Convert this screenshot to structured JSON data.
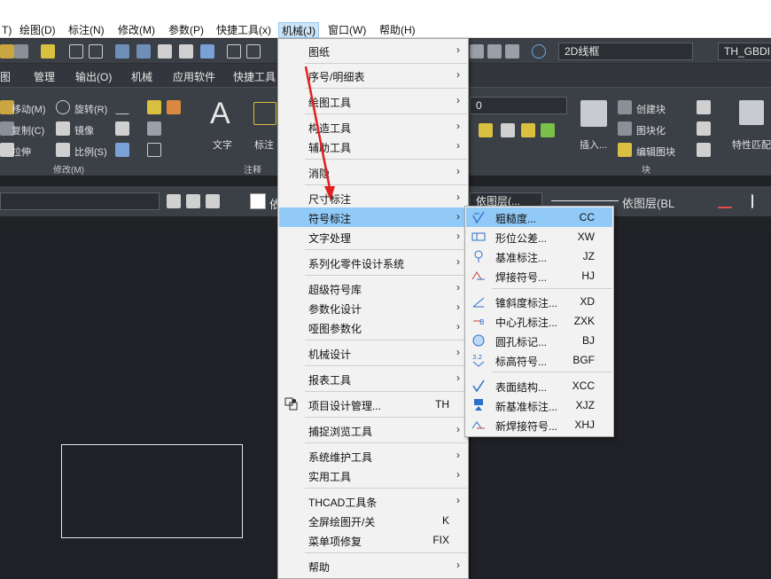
{
  "menubar": {
    "items": [
      "T)",
      "绘图(D)",
      "标注(N)",
      "修改(M)",
      "参数(P)",
      "快捷工具(x)",
      "机械(J)",
      "窗口(W)",
      "帮助(H)"
    ],
    "active_index": 6
  },
  "toolbar": {
    "view_style": "2D线框",
    "text_style": "TH_GBDIM"
  },
  "tabs": [
    "图",
    "管理",
    "输出(O)",
    "机械",
    "应用软件",
    "快捷工具"
  ],
  "ribbon": {
    "modify": {
      "move": "移动(M)",
      "rotate": "旋转(R)",
      "copy": "复制(C)",
      "mirror": "镜像",
      "stretch": "拉伸",
      "scale": "比例(S)",
      "group": "修改(M)"
    },
    "text": "文字",
    "dim": "标注",
    "annotate_group": "注释",
    "layer_value": "0",
    "insert": "插入...",
    "block": {
      "create": "创建块",
      "blockify": "图块化",
      "edit": "编辑图块",
      "group": "块"
    },
    "match_props": "特性匹配"
  },
  "props": {
    "left_label": "依",
    "layer": "依图层(...",
    "linetype": "依图层(BL"
  },
  "main_menu": [
    {
      "label": "图纸",
      "submenu": true
    },
    {
      "sep": true
    },
    {
      "label": "序号/明细表",
      "submenu": true
    },
    {
      "sep": true
    },
    {
      "label": "绘图工具",
      "submenu": true
    },
    {
      "sep": true
    },
    {
      "label": "构造工具",
      "submenu": true
    },
    {
      "label": "辅助工具",
      "submenu": true
    },
    {
      "sep": true
    },
    {
      "label": "消隐",
      "submenu": true
    },
    {
      "sep": true
    },
    {
      "label": "尺寸标注",
      "submenu": true
    },
    {
      "label": "符号标注",
      "submenu": true,
      "highlight": true
    },
    {
      "label": "文字处理",
      "submenu": true
    },
    {
      "sep": true
    },
    {
      "label": "系列化零件设计系统",
      "submenu": true
    },
    {
      "sep": true
    },
    {
      "label": "超级符号库",
      "submenu": true
    },
    {
      "label": "参数化设计",
      "submenu": true
    },
    {
      "label": "哑图参数化",
      "submenu": true
    },
    {
      "sep": true
    },
    {
      "label": "机械设计",
      "submenu": true
    },
    {
      "sep": true
    },
    {
      "label": "报表工具",
      "submenu": true
    },
    {
      "sep": true
    },
    {
      "label": "项目设计管理...",
      "shortcut": "TH",
      "icon": "project-icon"
    },
    {
      "sep": true
    },
    {
      "label": "捕捉浏览工具",
      "submenu": true
    },
    {
      "sep": true
    },
    {
      "label": "系统维护工具",
      "submenu": true
    },
    {
      "label": "实用工具",
      "submenu": true
    },
    {
      "sep": true
    },
    {
      "label": "THCAD工具条",
      "submenu": true
    },
    {
      "label": "全屏绘图开/关",
      "shortcut": "K"
    },
    {
      "label": "菜单项修复",
      "shortcut": "FIX"
    },
    {
      "sep": true
    },
    {
      "label": "帮助",
      "submenu": true
    }
  ],
  "sub_menu": [
    {
      "label": "粗糙度...",
      "shortcut": "CC",
      "icon": "roughness-icon",
      "highlight": true
    },
    {
      "label": "形位公差...",
      "shortcut": "XW",
      "icon": "tolerance-icon"
    },
    {
      "label": "基准标注...",
      "shortcut": "JZ",
      "icon": "datum-icon"
    },
    {
      "label": "焊接符号...",
      "shortcut": "HJ",
      "icon": "weld-icon"
    },
    {
      "sep": true
    },
    {
      "label": "锥斜度标注...",
      "shortcut": "XD",
      "icon": "taper-icon"
    },
    {
      "label": "中心孔标注...",
      "shortcut": "ZXK",
      "icon": "center-hole-icon"
    },
    {
      "label": "圆孔标记...",
      "shortcut": "BJ",
      "icon": "hole-mark-icon"
    },
    {
      "label": "标高符号...",
      "shortcut": "BGF",
      "icon": "elevation-icon"
    },
    {
      "sep": true
    },
    {
      "label": "表面结构...",
      "shortcut": "XCC",
      "icon": "surface-icon"
    },
    {
      "label": "新基准标注...",
      "shortcut": "XJZ",
      "icon": "new-datum-icon"
    },
    {
      "label": "新焊接符号...",
      "shortcut": "XHJ",
      "icon": "new-weld-icon"
    }
  ],
  "colors": {
    "highlight": "#91c9f7",
    "menu_bg": "#f2f2f2",
    "canvas": "#1f2126",
    "annotation_arrow": "#e02020"
  }
}
